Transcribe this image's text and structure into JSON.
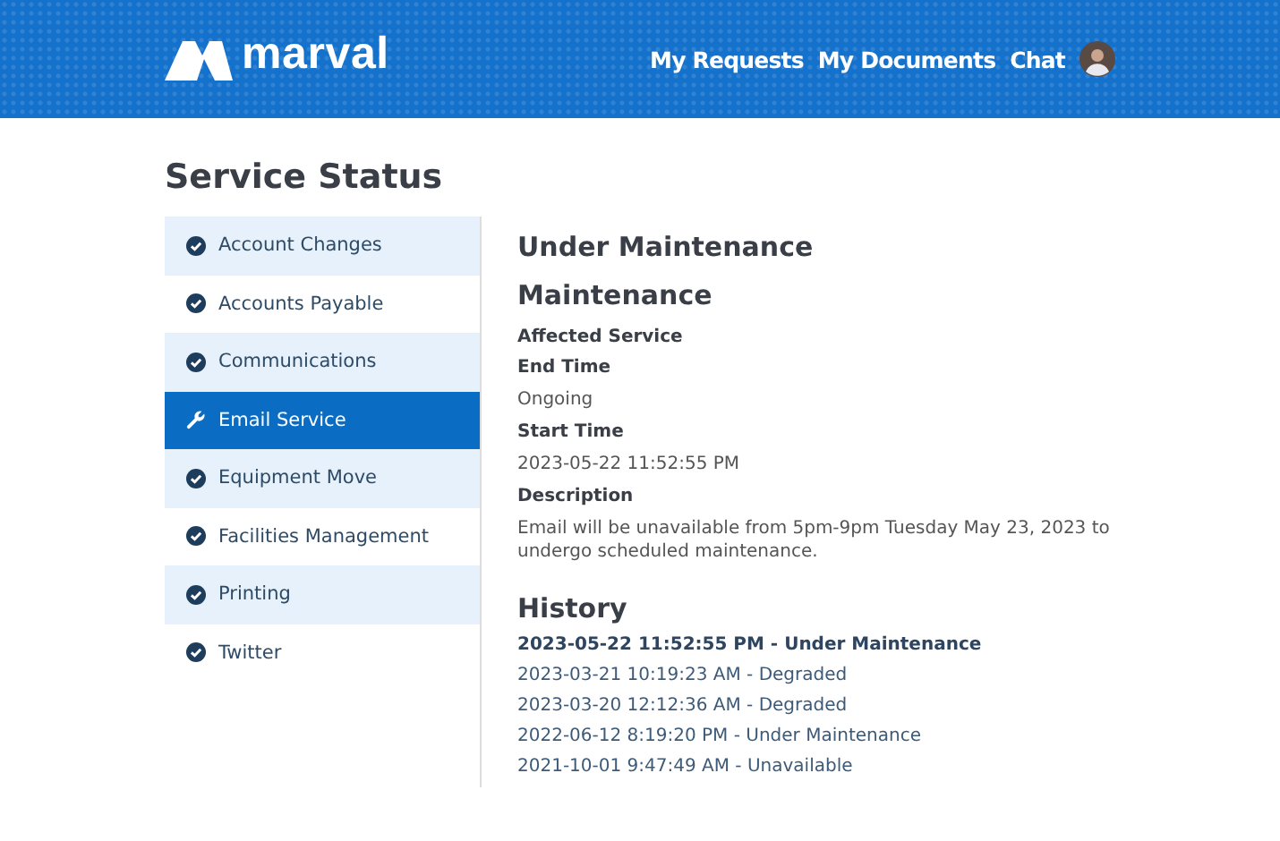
{
  "header": {
    "logo_text": "marval",
    "nav": [
      "My Requests",
      "My Documents",
      "Chat"
    ]
  },
  "page_title": "Service Status",
  "sidebar": {
    "items": [
      {
        "label": "Account Changes",
        "kind": "ok",
        "selected": false
      },
      {
        "label": "Accounts Payable",
        "kind": "ok",
        "selected": false
      },
      {
        "label": "Communications",
        "kind": "ok",
        "selected": false
      },
      {
        "label": "Email Service",
        "kind": "maintenance",
        "selected": true
      },
      {
        "label": "Equipment Move",
        "kind": "ok",
        "selected": false
      },
      {
        "label": "Facilities Management",
        "kind": "ok",
        "selected": false
      },
      {
        "label": "Printing",
        "kind": "ok",
        "selected": false
      },
      {
        "label": "Twitter",
        "kind": "ok",
        "selected": false
      }
    ]
  },
  "detail": {
    "status": "Under Maintenance",
    "title": "Maintenance",
    "fields": [
      {
        "label": "Affected Service"
      },
      {
        "label": "End Time",
        "value": "Ongoing"
      },
      {
        "label": "Start Time",
        "value": "2023-05-22 11:52:55 PM"
      },
      {
        "label": "Description",
        "value": "Email will be unavailable from 5pm-9pm Tuesday May 23, 2023 to undergo scheduled maintenance."
      }
    ]
  },
  "history": {
    "title": "History",
    "items": [
      {
        "text": "2023-05-22 11:52:55 PM - Under Maintenance",
        "selected": true
      },
      {
        "text": "2023-03-21 10:19:23 AM - Degraded",
        "selected": false
      },
      {
        "text": "2023-03-20 12:12:36 AM - Degraded",
        "selected": false
      },
      {
        "text": "2022-06-12 8:19:20 PM - Under Maintenance",
        "selected": false
      },
      {
        "text": "2021-10-01 9:47:49 AM - Unavailable",
        "selected": false
      }
    ]
  }
}
